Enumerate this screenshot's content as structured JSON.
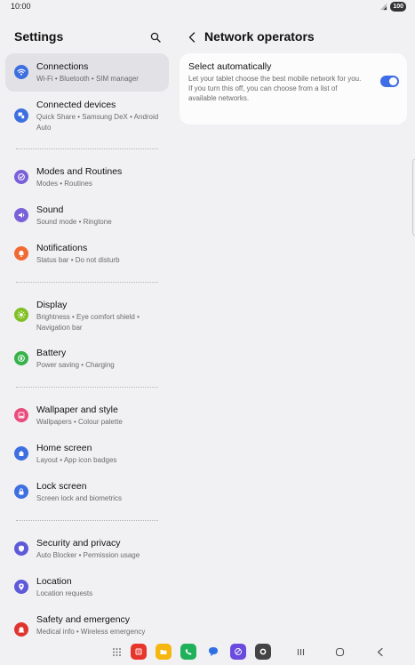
{
  "status_bar": {
    "time": "10:00",
    "battery": "100"
  },
  "sidebar": {
    "title": "Settings",
    "items": [
      {
        "title": "Connections",
        "subtitle": "Wi-Fi  •  Bluetooth  •  SIM manager",
        "icon": "wifi-icon",
        "color": "#3e6fe0",
        "active": true
      },
      {
        "title": "Connected devices",
        "subtitle": "Quick Share  •  Samsung DeX  •  Android Auto",
        "icon": "connected-devices-icon",
        "color": "#3e6fe0"
      },
      {
        "title": "Modes and Routines",
        "subtitle": "Modes  •  Routines",
        "icon": "modes-icon",
        "color": "#7a61d9"
      },
      {
        "title": "Sound",
        "subtitle": "Sound mode  •  Ringtone",
        "icon": "sound-icon",
        "color": "#7a61d9"
      },
      {
        "title": "Notifications",
        "subtitle": "Status bar  •  Do not disturb",
        "icon": "bell-icon",
        "color": "#f16a33"
      },
      {
        "title": "Display",
        "subtitle": "Brightness  •  Eye comfort shield  •  Navigation bar",
        "icon": "sun-icon",
        "color": "#7fbf23"
      },
      {
        "title": "Battery",
        "subtitle": "Power saving  •  Charging",
        "icon": "battery-icon",
        "color": "#36b34a"
      },
      {
        "title": "Wallpaper and style",
        "subtitle": "Wallpapers  •  Colour palette",
        "icon": "wallpaper-icon",
        "color": "#ea4b7e"
      },
      {
        "title": "Home screen",
        "subtitle": "Layout  •  App icon badges",
        "icon": "home-icon",
        "color": "#3e6fe0"
      },
      {
        "title": "Lock screen",
        "subtitle": "Screen lock and biometrics",
        "icon": "lock-icon",
        "color": "#3e6fe0"
      },
      {
        "title": "Security and privacy",
        "subtitle": "Auto Blocker  •  Permission usage",
        "icon": "shield-icon",
        "color": "#5e5ad9"
      },
      {
        "title": "Location",
        "subtitle": "Location requests",
        "icon": "location-pin-icon",
        "color": "#5e5ad9"
      },
      {
        "title": "Safety and emergency",
        "subtitle": "Medical info  •  Wireless emergency alerts",
        "icon": "emergency-icon",
        "color": "#e0352f"
      }
    ]
  },
  "detail": {
    "title": "Network operators",
    "card": {
      "title": "Select automatically",
      "description": "Let your tablet choose the best mobile network for you. If you turn this off, you can choose from a list of available networks.",
      "toggle_on": true
    }
  },
  "colors": {
    "accent": "#3e6de6",
    "background": "#f1f1f3",
    "card": "#fcfcfd"
  }
}
